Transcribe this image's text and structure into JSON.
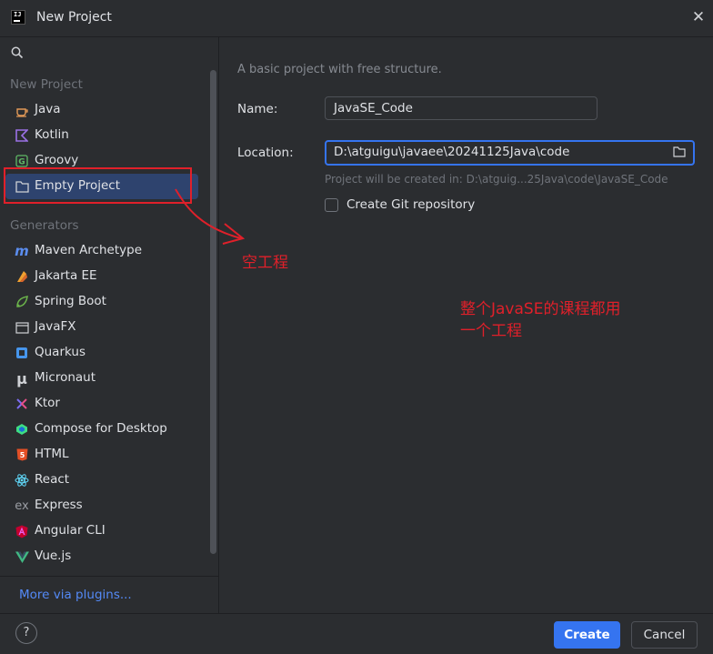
{
  "window": {
    "title": "New Project",
    "app_icon_text": "IJ"
  },
  "sidebar": {
    "new_project_header": "New Project",
    "generators_header": "Generators",
    "new_project_items": [
      {
        "label": "Java",
        "icon": "java-cup-icon"
      },
      {
        "label": "Kotlin",
        "icon": "kotlin-icon"
      },
      {
        "label": "Groovy",
        "icon": "groovy-icon"
      },
      {
        "label": "Empty Project",
        "icon": "folder-icon",
        "selected": true
      }
    ],
    "generator_items": [
      {
        "label": "Maven Archetype",
        "icon": "maven-icon"
      },
      {
        "label": "Jakarta EE",
        "icon": "jakarta-icon"
      },
      {
        "label": "Spring Boot",
        "icon": "spring-icon"
      },
      {
        "label": "JavaFX",
        "icon": "javafx-icon"
      },
      {
        "label": "Quarkus",
        "icon": "quarkus-icon"
      },
      {
        "label": "Micronaut",
        "icon": "micronaut-icon"
      },
      {
        "label": "Ktor",
        "icon": "ktor-icon"
      },
      {
        "label": "Compose for Desktop",
        "icon": "compose-icon"
      },
      {
        "label": "HTML",
        "icon": "html5-icon"
      },
      {
        "label": "React",
        "icon": "react-icon"
      },
      {
        "label": "Express",
        "icon": "express-icon"
      },
      {
        "label": "Angular CLI",
        "icon": "angular-icon"
      },
      {
        "label": "Vue.js",
        "icon": "vue-icon"
      }
    ],
    "more_plugins": "More via plugins..."
  },
  "main": {
    "description": "A basic project with free structure.",
    "name_label": "Name:",
    "name_value": "JavaSE_Code",
    "location_label": "Location:",
    "location_value": "D:\\atguigu\\javaee\\20241125Java\\code",
    "hint": "Project will be created in: D:\\atguig...25Java\\code\\JavaSE_Code",
    "git_label": "Create Git repository"
  },
  "annotations": {
    "empty_project_note": "空工程",
    "main_note_line1": "整个JavaSE的课程都用",
    "main_note_line2": "一个工程"
  },
  "footer": {
    "help": "?",
    "create": "Create",
    "cancel": "Cancel"
  },
  "colors": {
    "accent": "#3574f0",
    "annotation_red": "#e0202a",
    "background": "#2b2d30"
  }
}
